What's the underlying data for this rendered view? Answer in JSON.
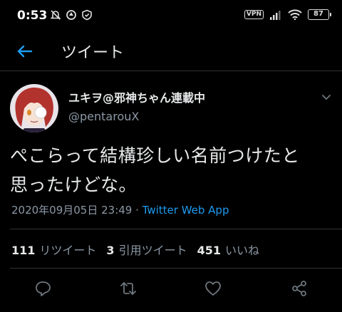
{
  "status_bar": {
    "time": "0:53",
    "vpn": "VPN",
    "battery": "87"
  },
  "nav": {
    "title": "ツイート"
  },
  "tweet": {
    "display_name": "ユキヲ@邪神ちゃん連載中",
    "username": "@pentarouX",
    "text_line1": "ぺこらって結構珍しい名前つけたと",
    "text_line2": "思ったけどな。",
    "timestamp": "2020年09月05日 23:49",
    "separator": " · ",
    "source": "Twitter Web App"
  },
  "stats": {
    "retweets_count": "111",
    "retweets_label": "リツイート",
    "quotes_count": "3",
    "quotes_label": "引用ツイート",
    "likes_count": "451",
    "likes_label": "いいね"
  },
  "colors": {
    "background": "#000000",
    "text": "#e7e9ea",
    "secondary": "#8b98a5",
    "accent": "#1d9bf0",
    "divider": "#2f3336"
  },
  "icons": [
    "arrow-left-icon",
    "chevron-down-icon",
    "reply-icon",
    "retweet-icon",
    "heart-icon",
    "share-icon"
  ]
}
